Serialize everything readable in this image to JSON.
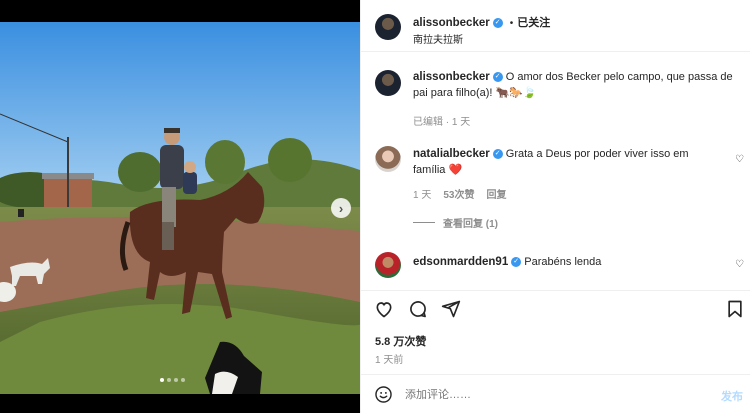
{
  "post": {
    "author": "alissonbecker",
    "follow_dot": "•",
    "follow_status": "已关注",
    "location": "南拉夫拉斯"
  },
  "caption": {
    "username": "alissonbecker",
    "text": "O amor dos Becker pelo campo, que passa de pai para filho(a)! 🐂🐎🍃",
    "meta": "已编辑 · 1 天"
  },
  "comments": [
    {
      "username": "natalialbecker",
      "text": "Grata a Deus por poder viver isso em família ❤️",
      "time": "1 天",
      "likes": "53次赞",
      "reply": "回复",
      "view_replies": "查看回复 (1)"
    },
    {
      "username": "edsonmardden91",
      "text": "Parabéns lenda"
    }
  ],
  "likes_count": "5.8 万次赞",
  "posted_time": "1 天前",
  "comment_input": {
    "placeholder": "添加评论……",
    "post_label": "发布"
  },
  "icons": {
    "verified": "✓",
    "next": "›",
    "small_heart": "♡"
  },
  "colors": {
    "verified": "#3897f0",
    "post_button": "#b3dbff"
  }
}
